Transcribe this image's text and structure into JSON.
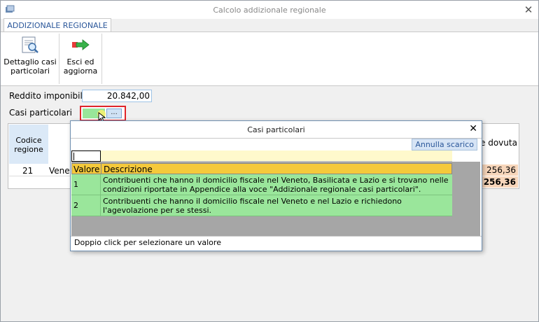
{
  "window": {
    "title": "Calcolo addizionale regionale",
    "close_icon": "close-icon"
  },
  "ribbon": {
    "tab_label": "ADDIZIONALE REGIONALE",
    "buttons": [
      {
        "label_line1": "Dettaglio casi",
        "label_line2": "particolari",
        "icon": "document-magnifier-icon"
      },
      {
        "label_line1": "Esci ed",
        "label_line2": "aggiorna",
        "icon": "exit-arrow-icon"
      }
    ]
  },
  "form": {
    "reddito_label": "Reddito imponibile",
    "reddito_value": "20.842,00",
    "casi_label": "Casi particolari",
    "casi_button": "..."
  },
  "background_table": {
    "header_codice_line1": "Codice",
    "header_codice_line2": "regione",
    "header_dovuta": "e dovuta",
    "row_code": "21",
    "row_name": "Venet",
    "row_value": "256,36",
    "total_value": "256,36"
  },
  "popup": {
    "title": "Casi particolari",
    "annulla_label": "Annulla scarico",
    "columns": {
      "valore": "Valore",
      "descrizione": "Descrizione"
    },
    "rows": [
      {
        "valore": "1",
        "descrizione": "Contribuenti che hanno il domicilio fiscale nel Veneto, Basilicata e Lazio e si trovano nelle condizioni riportate in Appendice alla voce \"Addizionale regionale casi particolari\"."
      },
      {
        "valore": "2",
        "descrizione": "Contribuenti che hanno il domicilio fiscale nel Veneto e nel Lazio e richiedono l'agevolazione per se stessi."
      }
    ],
    "footer": "Doppio click per selezionare un valore"
  },
  "colors": {
    "accent": "#2b579a",
    "selected_row": "#9ae69b",
    "header": "#f5c93b",
    "filter": "#fff9cc",
    "highlight_border": "#e0252a",
    "amount_bg": "#f7d6bb"
  }
}
